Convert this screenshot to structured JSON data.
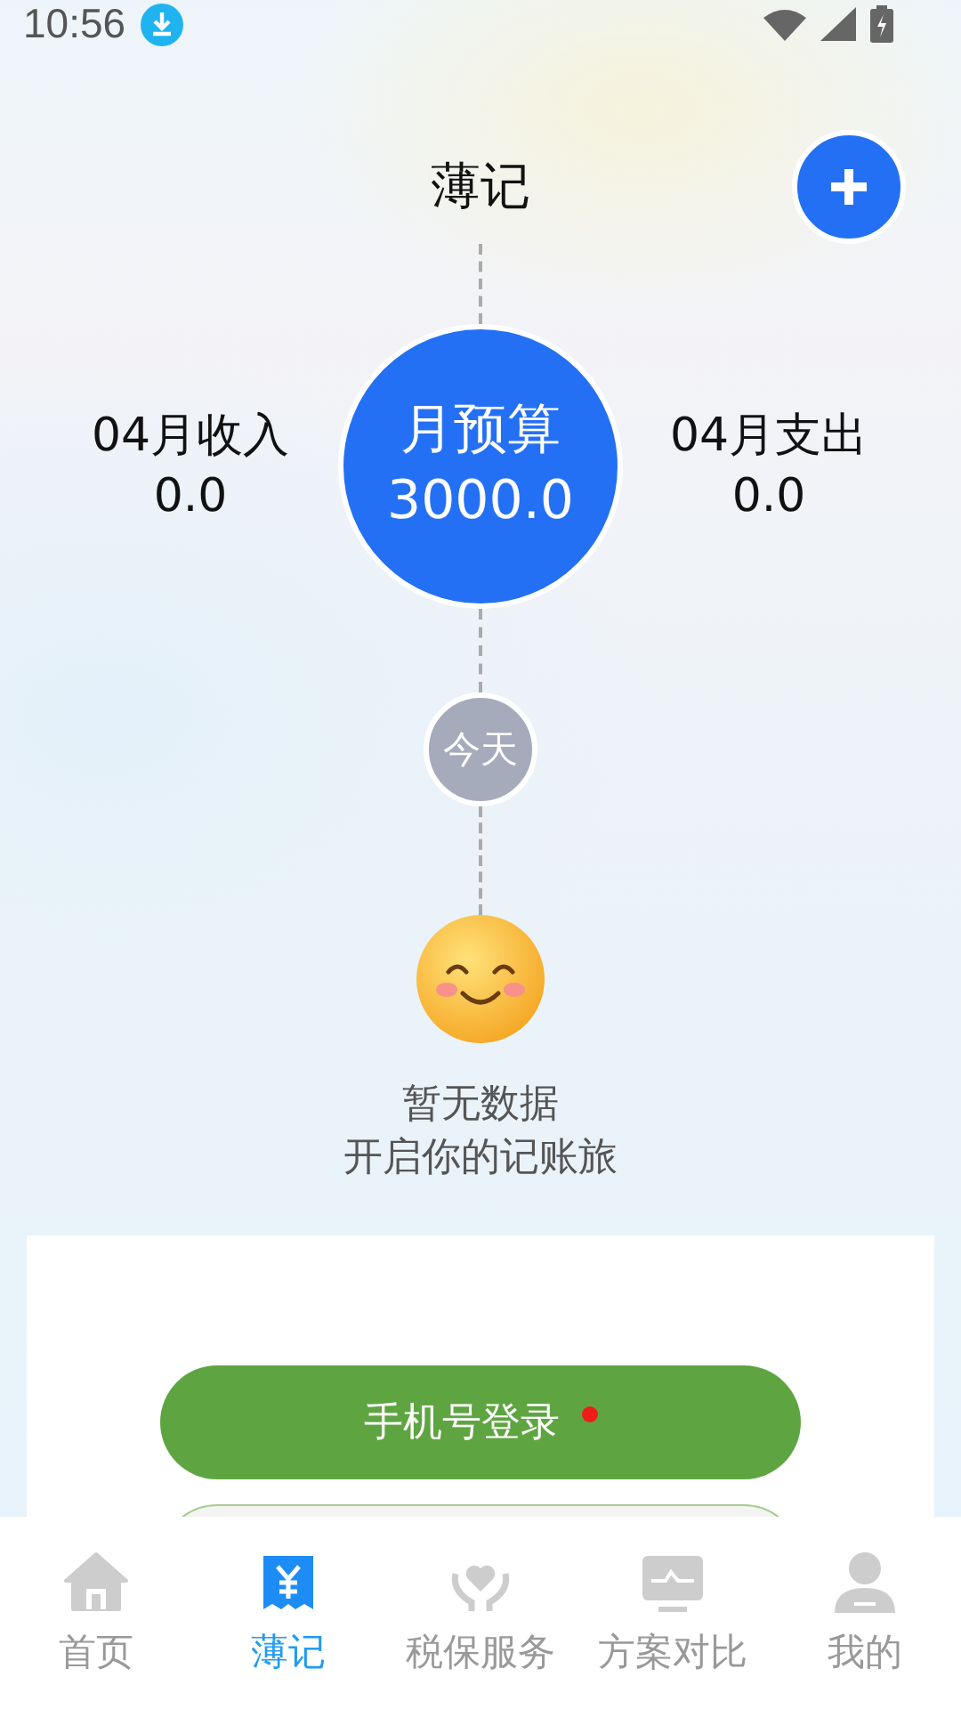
{
  "status_bar": {
    "time": "10:56"
  },
  "header": {
    "title": "薄记"
  },
  "summary": {
    "income_label": "04月收入",
    "income": "0.0",
    "budget_label": "月预算",
    "budget": "3000.0",
    "expense_label": "04月支出",
    "expense": "0.0"
  },
  "today": "今天",
  "empty_state": [
    "暂无数据",
    "开启你的记账旅"
  ],
  "login": {
    "button": "手机号登录"
  },
  "tabs": [
    {
      "label": "首页",
      "kind": "home",
      "selected": false
    },
    {
      "label": "薄记",
      "kind": "ledger",
      "selected": true
    },
    {
      "label": "税保服务",
      "kind": "care",
      "selected": false
    },
    {
      "label": "方案对比",
      "kind": "monitor",
      "selected": false
    },
    {
      "label": "我的",
      "kind": "profile",
      "selected": false
    }
  ]
}
